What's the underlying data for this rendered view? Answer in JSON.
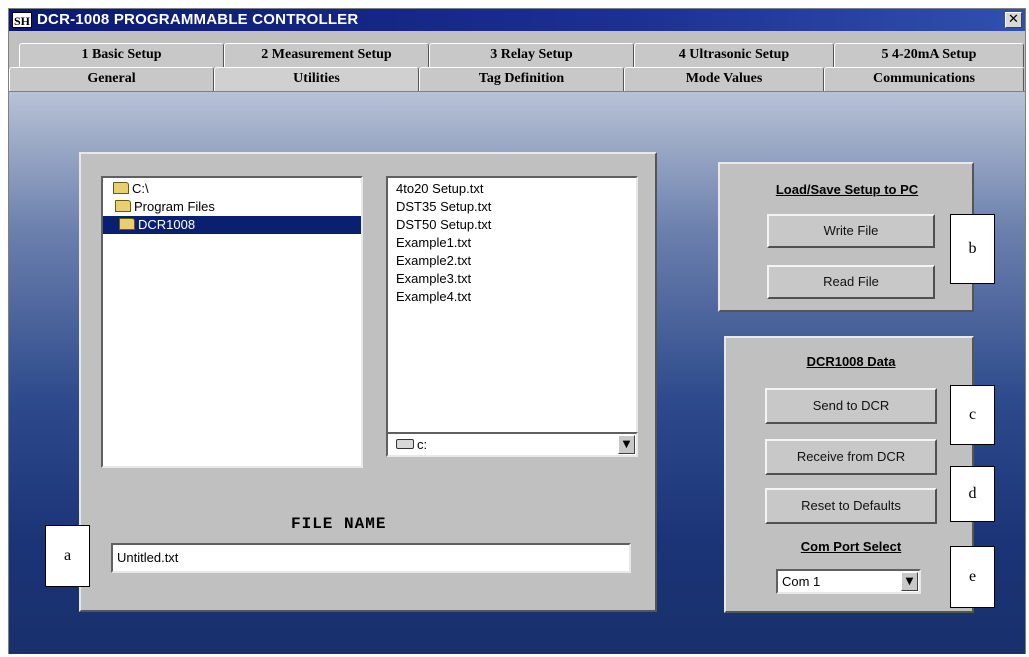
{
  "window": {
    "icon_text": "SH",
    "title": "DCR-1008 PROGRAMMABLE CONTROLLER",
    "close_glyph": "✕"
  },
  "tabs_row1": [
    "1 Basic Setup",
    "2 Measurement Setup",
    "3 Relay Setup",
    "4 Ultrasonic Setup",
    "5 4-20mA Setup"
  ],
  "tabs_row2": [
    "General",
    "Utilities",
    "Tag Definition",
    "Mode Values",
    "Communications"
  ],
  "active_tab": "Utilities",
  "file_panel": {
    "directories": [
      "C:\\",
      "Program Files",
      "DCR1008"
    ],
    "selected_directory": "DCR1008",
    "files": [
      "4to20 Setup.txt",
      "DST35 Setup.txt",
      "DST50 Setup.txt",
      "Example1.txt",
      "Example2.txt",
      "Example3.txt",
      "Example4.txt"
    ],
    "drive": "c:",
    "file_name_label": "FILE NAME",
    "file_name_value": "Untitled.txt"
  },
  "load_save_panel": {
    "title": "Load/Save Setup to PC",
    "write_file": "Write File",
    "read_file": "Read File"
  },
  "dcr_panel": {
    "title": "DCR1008 Data",
    "send": "Send to DCR",
    "receive": "Receive from DCR",
    "reset": "Reset to Defaults",
    "com_port_label": "Com Port Select",
    "com_port_value": "Com 1"
  },
  "callouts": {
    "a": "a",
    "b": "b",
    "c": "c",
    "d": "d",
    "e": "e"
  },
  "icons": {
    "folder": "folder-icon",
    "drive": "drive-icon",
    "dropdown": "▼"
  },
  "colors": {
    "title_bar": "#0a1872",
    "selection": "#0b1f70",
    "panel": "#c0c0c0"
  }
}
